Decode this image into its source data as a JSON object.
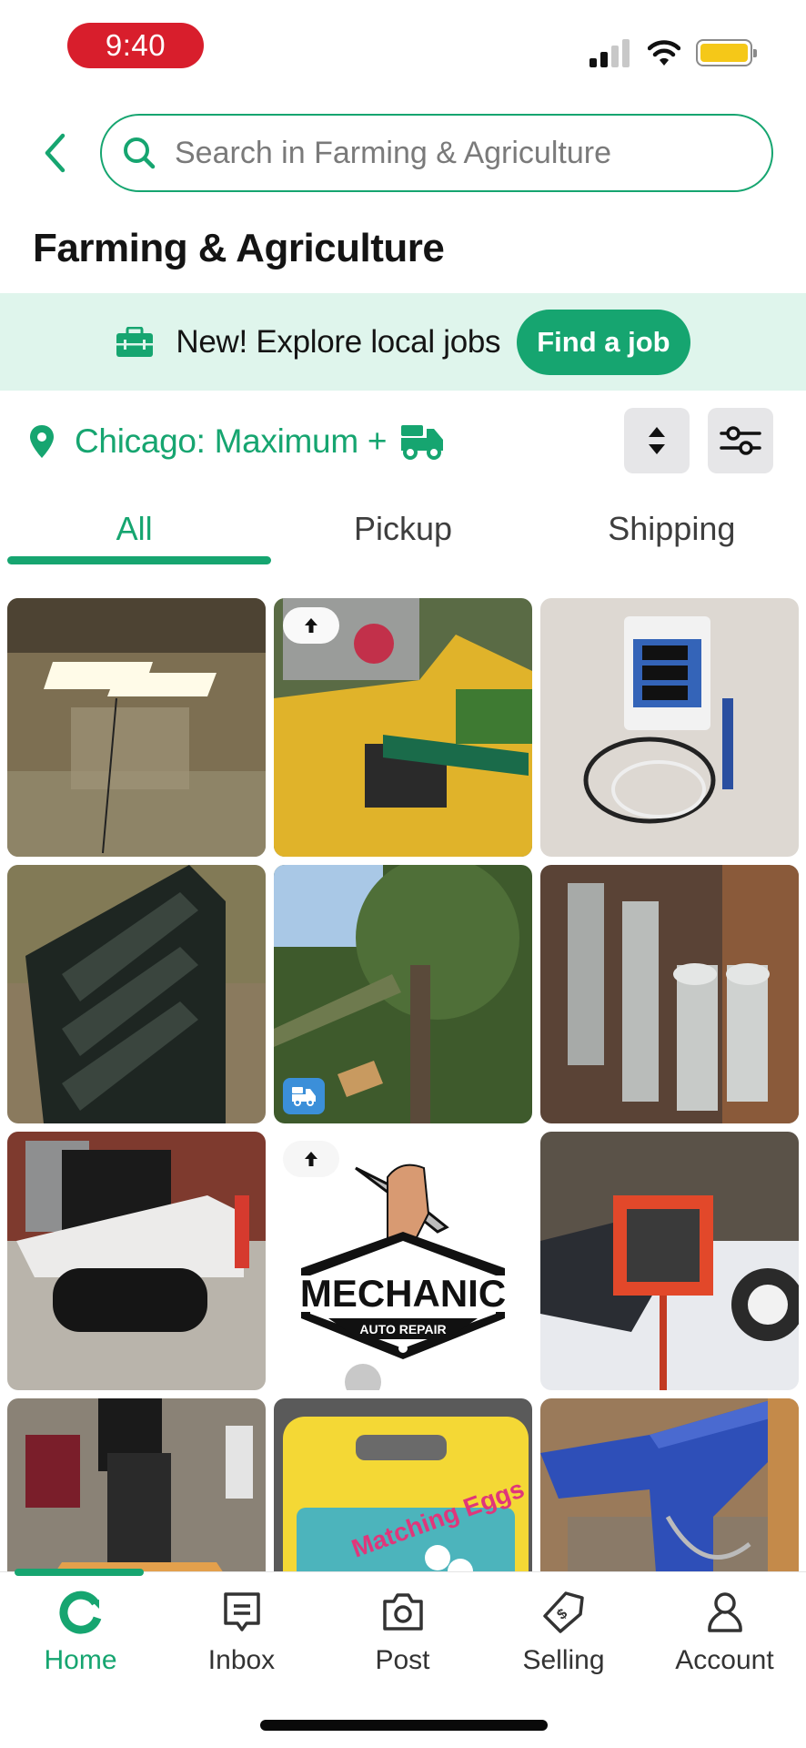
{
  "status_bar": {
    "time": "9:40",
    "signal_bars_active": 2,
    "signal_bars_total": 4,
    "battery_color": "#f5c818"
  },
  "header": {
    "back_icon": "chevron-left-icon",
    "search_placeholder": "Search in Farming & Agriculture",
    "search_value": ""
  },
  "page": {
    "title": "Farming & Agriculture"
  },
  "jobs_banner": {
    "icon": "briefcase-icon",
    "text": "New! Explore local jobs",
    "button_label": "Find a job"
  },
  "location": {
    "icon": "map-pin-icon",
    "label": "Chicago: Maximum +",
    "shipping_icon": "truck-icon"
  },
  "controls": {
    "sort_icon": "sort-icon",
    "filter_icon": "sliders-icon"
  },
  "tabs": [
    {
      "label": "All",
      "active": true
    },
    {
      "label": "Pickup",
      "active": false
    },
    {
      "label": "Shipping",
      "active": false
    }
  ],
  "listings": [
    {
      "subject": "LED grow light in basement",
      "badge": null
    },
    {
      "subject": "Yellow Vermeer wood chipper",
      "badge": "boost"
    },
    {
      "subject": "Digital pH / EC monitor with probes",
      "badge": null
    },
    {
      "subject": "Black root grapple attachment",
      "badge": null
    },
    {
      "subject": "Tree removal service",
      "badge": "shipping"
    },
    {
      "subject": "Aluminum hydroponic reflector tubes",
      "badge": null
    },
    {
      "subject": "White compact track loader",
      "badge": null
    },
    {
      "subject": "Mechanic auto repair logo",
      "badge": "boost",
      "logo_title": "MECHANIC",
      "logo_subtitle": "AUTO REPAIR"
    },
    {
      "subject": "Orange utility trailer cart in snow",
      "badge": null
    },
    {
      "subject": "Scag commercial lawn mower",
      "badge": null
    },
    {
      "subject": "Matching Eggs toy set",
      "badge": null,
      "box_text": "Matching Eggs"
    },
    {
      "subject": "Blue anvil on tree stump",
      "badge": null
    }
  ],
  "bottom_nav": [
    {
      "label": "Home",
      "icon": "home-icon",
      "active": true
    },
    {
      "label": "Inbox",
      "icon": "inbox-icon",
      "active": false
    },
    {
      "label": "Post",
      "icon": "camera-icon",
      "active": false
    },
    {
      "label": "Selling",
      "icon": "price-tag-icon",
      "active": false
    },
    {
      "label": "Account",
      "icon": "person-icon",
      "active": false
    }
  ],
  "colors": {
    "accent": "#16a570",
    "banner_bg": "#dff5ec",
    "time_pill": "#d81e2c",
    "ship_badge": "#3b8fd9"
  }
}
